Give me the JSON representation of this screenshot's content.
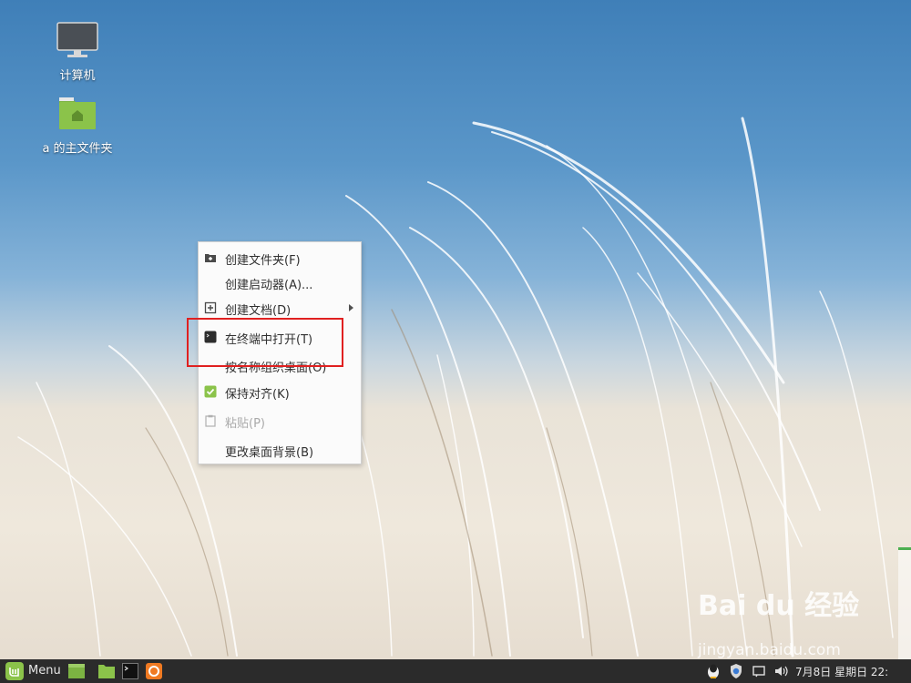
{
  "desktop": {
    "icons": [
      {
        "label": "计算机",
        "icon": "computer-monitor-icon"
      },
      {
        "label": "a 的主文件夹",
        "icon": "home-folder-icon"
      }
    ]
  },
  "context_menu": {
    "items": [
      {
        "label": "创建文件夹(F)",
        "icon": "folder-add-icon"
      },
      {
        "label": "创建启动器(A)...",
        "icon": ""
      },
      {
        "label": "创建文档(D)",
        "icon": "document-add-icon",
        "submenu": true
      },
      {
        "label": "在终端中打开(T)",
        "icon": "terminal-icon"
      },
      {
        "label": "按名称组织桌面(O)",
        "icon": ""
      },
      {
        "label": "保持对齐(K)",
        "icon": "checkbox-checked-icon",
        "checked": true
      },
      {
        "label": "粘贴(P)",
        "icon": "paste-icon",
        "disabled": true
      },
      {
        "label": "更改桌面背景(B)",
        "icon": ""
      }
    ]
  },
  "taskbar": {
    "menu_label": "Menu",
    "clock": "7月8日 星期日 22:"
  },
  "watermark": {
    "logo": "Bai du 经验",
    "url": "jingyan.baidu.com"
  },
  "colors": {
    "highlight_border": "#e02020",
    "mint_green": "#8bc34a",
    "taskbar_bg": "#2b2b2b"
  }
}
